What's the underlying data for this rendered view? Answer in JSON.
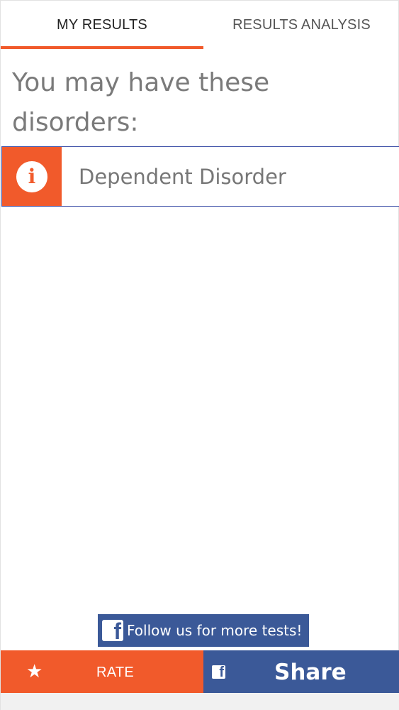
{
  "tabs": {
    "my_results": "MY RESULTS",
    "results_analysis": "RESULTS ANALYSIS"
  },
  "heading": "You may have these disorders:",
  "results": [
    {
      "label": "Dependent Disorder",
      "icon": "info-icon"
    }
  ],
  "follow_banner": {
    "icon": "facebook-icon",
    "text": "Follow us for more tests!"
  },
  "bottom_bar": {
    "rate_icon": "star-icon",
    "rate_label": "RATE",
    "share_icon": "facebook-icon",
    "share_label": "Share"
  },
  "colors": {
    "accent": "#f15a2b",
    "facebook": "#3b5998",
    "card_border": "#3f51a8"
  }
}
